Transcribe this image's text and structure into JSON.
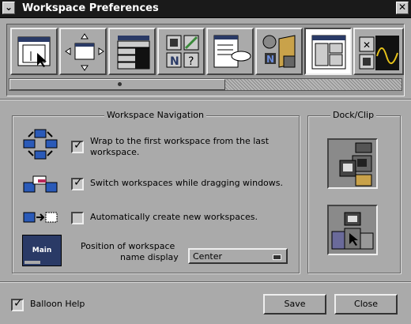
{
  "window": {
    "title": "Workspace Preferences",
    "menu_icon": "minimize-icon",
    "close_icon": "close-icon"
  },
  "toolbar": {
    "items": [
      {
        "id": "window-handling",
        "icon": "window-cursor-icon",
        "selected": false
      },
      {
        "id": "window-placement",
        "icon": "window-move-icon",
        "selected": false
      },
      {
        "id": "menu-preferences",
        "icon": "menu-icon",
        "selected": false
      },
      {
        "id": "icon-preferences",
        "icon": "icons-grid-icon",
        "selected": false
      },
      {
        "id": "balloon-help",
        "icon": "balloon-window-icon",
        "selected": false
      },
      {
        "id": "applications",
        "icon": "apps-folder-icon",
        "selected": false
      },
      {
        "id": "workspace",
        "icon": "workspace-window-icon",
        "selected": true
      },
      {
        "id": "miscellaneous",
        "icon": "misc-icon",
        "selected": false
      }
    ],
    "scroll_fraction": 0.55
  },
  "navigation": {
    "title": "Workspace Navigation",
    "options": [
      {
        "label_line1": "Wrap to the first workspace from the last",
        "label_line2": "workspace.",
        "checked": true,
        "icon": "wrap-workspaces-icon"
      },
      {
        "label": "Switch workspaces while dragging windows.",
        "checked": true,
        "icon": "drag-switch-icon"
      },
      {
        "label": "Automatically create new workspaces.",
        "checked": false,
        "icon": "create-workspace-icon"
      }
    ],
    "position_label_line1": "Position of workspace",
    "position_label_line2": "name display",
    "position_value": "Center",
    "main_label": "Main"
  },
  "dock": {
    "title": "Dock/Clip"
  },
  "footer": {
    "balloon_help_label": "Balloon Help",
    "balloon_help_checked": true,
    "save_label": "Save",
    "close_label": "Close"
  },
  "colors": {
    "background": "#aaaaaa",
    "titlebar": "#1a1a1a",
    "selected": "#ffffff"
  }
}
